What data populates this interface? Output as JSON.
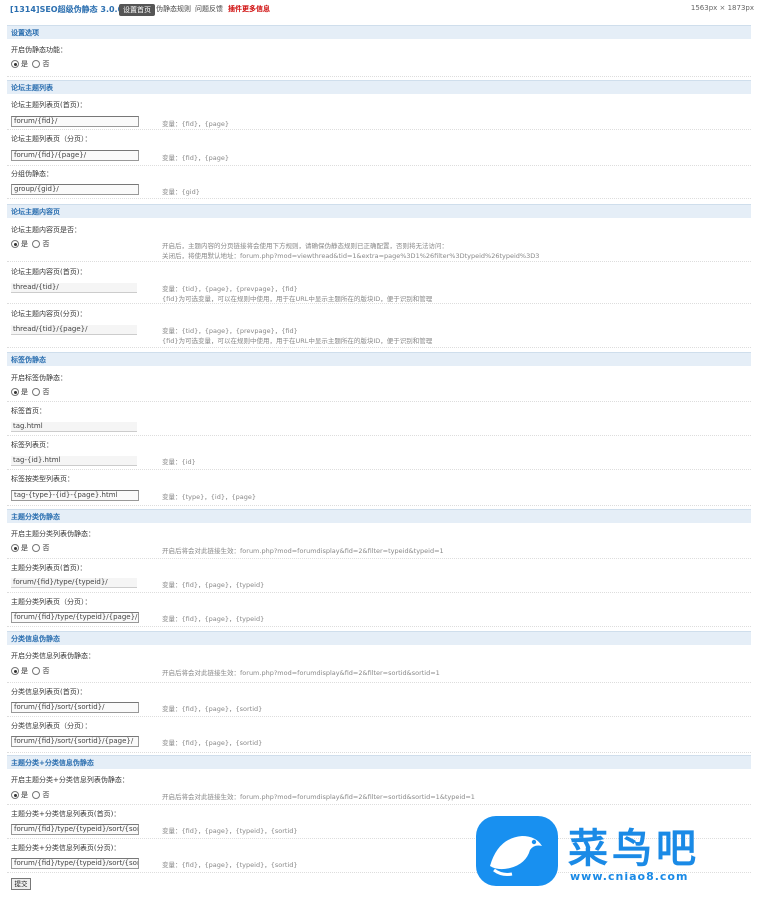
{
  "header": {
    "title": "[1314]SEO超级伪静态 3.0.0",
    "tabs": [
      {
        "label": "设置首页",
        "active": true
      },
      {
        "label": "伪静态规则",
        "active": false
      },
      {
        "label": "问题反馈",
        "active": false
      },
      {
        "label": "插件更多信息",
        "active": false
      }
    ],
    "dims": "1563px × 1873px"
  },
  "sections": {
    "basic": "设置选项",
    "forum_list": "论坛主题列表",
    "thread": "论坛主题内容页",
    "tag": "标签伪静态",
    "type": "主题分类伪静态",
    "sort": "分类信息伪静态",
    "type_sort": "主题分类+分类信息伪静态"
  },
  "rows": {
    "enable_label": "开启伪静态功能：",
    "yes": "是",
    "no": "否",
    "forum_home_label": "论坛主题列表页(首页)：",
    "forum_home_value": "forum/{fid}/",
    "forum_home_hint": "变量：{fid}，{page}",
    "forum_page_label": "论坛主题列表页（分页）：",
    "forum_page_value": "forum/{fid}/{page}/",
    "forum_page_hint": "变量：{fid}，{page}",
    "group_label": "分组伪静态：",
    "group_value": "group/{gid}/",
    "group_hint": "变量：{gid}",
    "thread_on_label": "论坛主题内容页是否：",
    "thread_on_hint1": "开启后，主题内容的分页链接将会使用下方规则，请确保伪静态规则已正确配置，否则将无法访问：",
    "thread_on_hint2": "关闭后，将使用默认地址：forum.php?mod=viewthread&tid=1&extra=page%3D1%26filter%3Dtypeid%26typeid%3D3",
    "thread_label": "论坛主题内容页(首页)：",
    "thread_value": "thread/{tid}/",
    "thread_hint1": "变量：{tid}，{page}，{prevpage}，{fid}",
    "thread_hint2": "{fid}为可选变量，可以在规则中使用，用于在URL中显示主题所在的版块ID，便于识别和管理",
    "thread_page_label": "论坛主题内容页(分页)：",
    "thread_page_value": "thread/{tid}/{page}/",
    "thread_page_hint1": "变量：{tid}，{page}，{prevpage}，{fid}",
    "thread_page_hint2": "{fid}为可选变量，可以在规则中使用，用于在URL中显示主题所在的版块ID，便于识别和管理",
    "tag_on_label": "开启标签伪静态：",
    "tag_home_label": "标签首页：",
    "tag_home_value": "tag.html",
    "tag_list_label": "标签列表页：",
    "tag_list_value": "tag-{id}.html",
    "tag_list_hint": "变量：{id}",
    "tag_type_label": "标签按类型列表页：",
    "tag_type_value": "tag-{type}-{id}-{page}.html",
    "tag_type_hint": "变量：{type}，{id}，{page}",
    "type_on_label": "开启主题分类列表伪静态：",
    "type_on_hint": "开启后将会对此链接生效：forum.php?mod=forumdisplay&fid=2&filter=typeid&typeid=1",
    "type_home_label": "主题分类列表页(首页)：",
    "type_home_value": "forum/{fid}/type/{typeid}/",
    "type_home_hint": "变量：{fid}，{page}，{typeid}",
    "type_page_label": "主题分类列表页（分页）：",
    "type_page_value": "forum/{fid}/type/{typeid}/{page}/",
    "type_page_hint": "变量：{fid}，{page}，{typeid}",
    "sort_on_label": "开启分类信息列表伪静态：",
    "sort_on_hint": "开启后将会对此链接生效：forum.php?mod=forumdisplay&fid=2&filter=sortid&sortid=1",
    "sort_home_label": "分类信息列表页(首页)：",
    "sort_home_value": "forum/{fid}/sort/{sortid}/",
    "sort_home_hint": "变量：{fid}，{page}，{sortid}",
    "sort_page_label": "分类信息列表页（分页）：",
    "sort_page_value": "forum/{fid}/sort/{sortid}/{page}/",
    "sort_page_hint": "变量：{fid}，{page}，{sortid}",
    "ts_on_label": "开启主题分类+分类信息列表伪静态：",
    "ts_on_hint": "开启后将会对此链接生效：forum.php?mod=forumdisplay&fid=2&filter=sortid&sortid=1&typeid=1",
    "ts_home_label": "主题分类+分类信息列表页(首页)：",
    "ts_home_value": "forum/{fid}/type/{typeid}/sort/{sortid}/",
    "ts_home_hint": "变量：{fid}，{page}，{typeid}，{sortid}",
    "ts_page_label": "主题分类+分类信息列表页(分页)：",
    "ts_page_value": "forum/{fid}/type/{typeid}/sort/{sortid}/",
    "ts_page_hint": "变量：{fid}，{page}，{typeid}，{sortid}"
  },
  "submit_label": "提交",
  "watermark": {
    "name": "菜鸟吧",
    "url": "www.cniao8.com"
  }
}
